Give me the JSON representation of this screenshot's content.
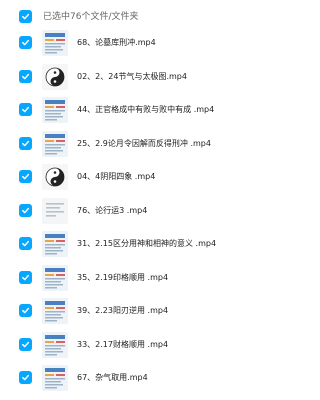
{
  "header": {
    "select_all_icon": "checkbox-checked-icon",
    "selected_text": "已选中76个文件/文件夹"
  },
  "colors": {
    "accent": "#06a7ff",
    "text": "#222222",
    "muted": "#666666"
  },
  "files": [
    {
      "name": "68、论墓库刑冲.mp4",
      "thumb": "slide",
      "checked": true
    },
    {
      "name": "02、2、24节气与太极图.mp4",
      "thumb": "taiji",
      "checked": true
    },
    {
      "name": "44、正官格成中有败与败中有成 .mp4",
      "thumb": "slide",
      "checked": true
    },
    {
      "name": "25、2.9论月令因解而反得刑冲 .mp4",
      "thumb": "slide",
      "checked": true
    },
    {
      "name": "04、4阴阳四象 .mp4",
      "thumb": "taiji",
      "checked": true
    },
    {
      "name": "76、论行运3 .mp4",
      "thumb": "plain",
      "checked": true
    },
    {
      "name": "31、2.15区分用神和相神的意义 .mp4",
      "thumb": "slide",
      "checked": true
    },
    {
      "name": "35、2.19印格顺用 .mp4",
      "thumb": "slide",
      "checked": true
    },
    {
      "name": "39、2.23阳刃逆用 .mp4",
      "thumb": "slide",
      "checked": true
    },
    {
      "name": "33、2.17财格顺用 .mp4",
      "thumb": "slide",
      "checked": true
    },
    {
      "name": "67、杂气取用.mp4",
      "thumb": "slide",
      "checked": true
    }
  ]
}
